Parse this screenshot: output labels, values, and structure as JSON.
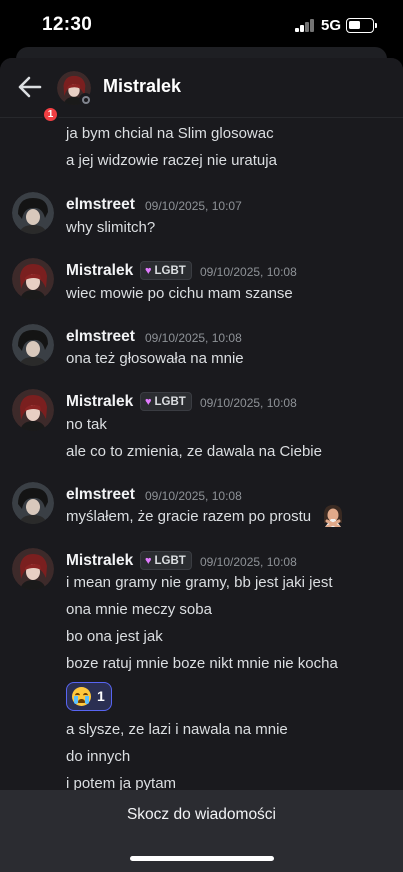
{
  "status_bar": {
    "time": "12:30",
    "network": "5G"
  },
  "header": {
    "title": "Mistralek",
    "back_badge": "1"
  },
  "messages": {
    "m0": {
      "lines": [
        "ja bym chcial na Slim glosowac",
        "a jej widzowie raczej nie uratuja"
      ]
    },
    "m1": {
      "author": "elmstreet",
      "timestamp": "09/10/2025, 10:07",
      "lines": [
        "why slimitch?"
      ]
    },
    "m2": {
      "author": "Mistralek",
      "role_tag": "LGBT",
      "timestamp": "09/10/2025, 10:08",
      "lines": [
        "wiec mowie po cichu mam szanse"
      ]
    },
    "m3": {
      "author": "elmstreet",
      "timestamp": "09/10/2025, 10:08",
      "lines": [
        "ona też głosowała na mnie"
      ]
    },
    "m4": {
      "author": "Mistralek",
      "role_tag": "LGBT",
      "timestamp": "09/10/2025, 10:08",
      "lines": [
        "no tak",
        "ale co to zmienia, ze dawala na Ciebie"
      ]
    },
    "m5": {
      "author": "elmstreet",
      "timestamp": "09/10/2025, 10:08",
      "lines": [
        "myślałem, że gracie razem po prostu"
      ],
      "trailing_emoji": "woman-gesturing-no-emoji"
    },
    "m6": {
      "author": "Mistralek",
      "role_tag": "LGBT",
      "timestamp": "09/10/2025, 10:08",
      "lines": [
        "i mean gramy nie gramy, bb jest jaki jest",
        "ona mnie meczy soba",
        "bo ona jest jak",
        "boze ratuj mnie boze nikt mnie nie kocha",
        "a slysze, ze lazi i nawala na mnie",
        "do innych",
        "i potem ja pytam"
      ],
      "reaction": {
        "emoji": "loudly-crying-face-emoji",
        "count": "1"
      }
    }
  },
  "jump_bar": {
    "label": "Skocz do wiadomości"
  },
  "colors": {
    "accent": "#5865f2",
    "badge": "#f23f43",
    "role_heart": "#e27bff",
    "background": "#1a1a1e"
  }
}
